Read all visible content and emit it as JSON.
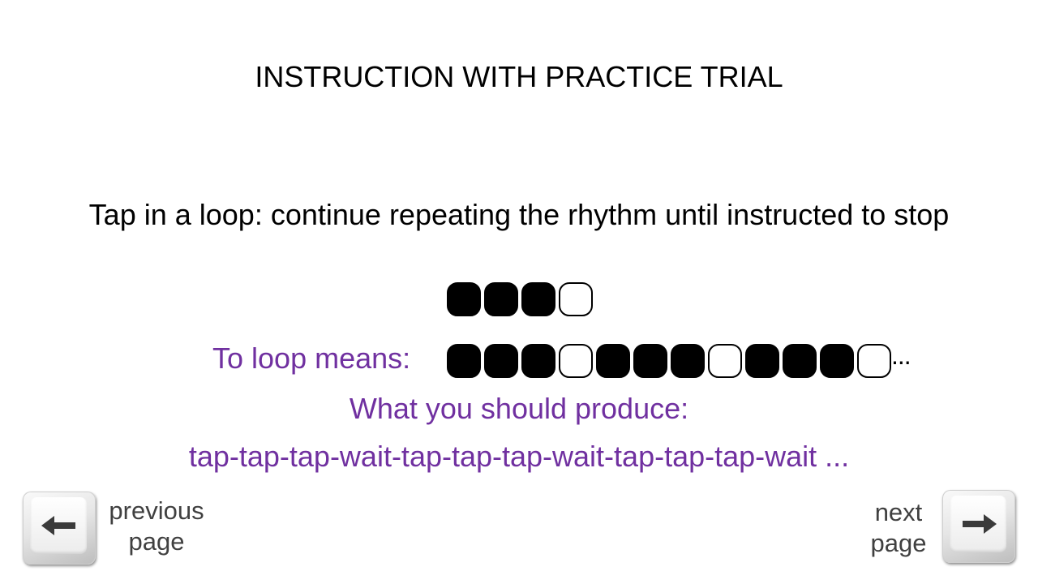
{
  "page_title": "INSTRUCTION WITH PRACTICE TRIAL",
  "instruction": "Tap in a loop: continue repeating the rhythm until instructed to stop",
  "rhythm_pattern": [
    "tap",
    "tap",
    "tap",
    "wait"
  ],
  "loop": {
    "label": "To loop means:",
    "sequence": [
      "tap",
      "tap",
      "tap",
      "wait",
      "tap",
      "tap",
      "tap",
      "wait",
      "tap",
      "tap",
      "tap",
      "wait"
    ],
    "continuation": "..."
  },
  "produce": {
    "label": "What you should produce:",
    "text": "tap-tap-tap-wait-tap-tap-tap-wait-tap-tap-tap-wait ..."
  },
  "navigation": {
    "previous": {
      "line1": "previous",
      "line2": "page",
      "icon": "arrow-left-key"
    },
    "next": {
      "line1": "next",
      "line2": "page",
      "icon": "arrow-right-key"
    }
  },
  "colors": {
    "accent_purple": "#7030a0",
    "tap_fill": "#000000",
    "wait_fill": "#ffffff",
    "nav_text": "#404040"
  }
}
